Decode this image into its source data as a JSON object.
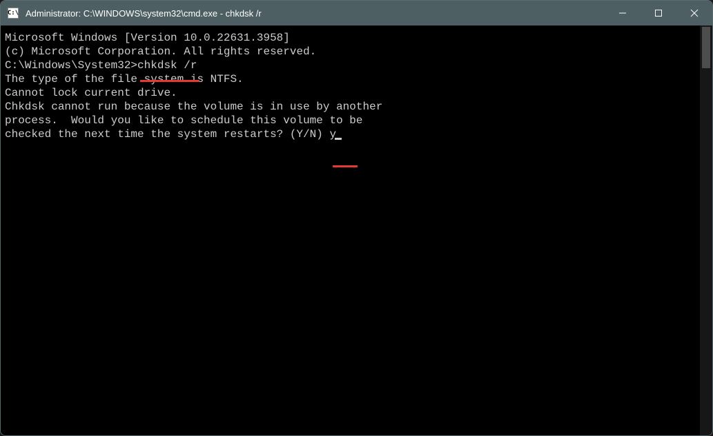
{
  "window": {
    "title": "Administrator: C:\\WINDOWS\\system32\\cmd.exe - chkdsk  /r",
    "icon_label": "C:\\"
  },
  "terminal": {
    "line1": "Microsoft Windows [Version 10.0.22631.3958]",
    "line2": "(c) Microsoft Corporation. All rights reserved.",
    "blank1": "",
    "prompt_prefix": "C:\\Windows\\System32>",
    "prompt_command": "chkdsk /r",
    "line4": "The type of the file system is NTFS.",
    "line5": "Cannot lock current drive.",
    "blank2": "",
    "line6": "Chkdsk cannot run because the volume is in use by another",
    "line7": "process.  Would you like to schedule this volume to be",
    "line8_prefix": "checked the next time the system restarts? (Y/N) ",
    "line8_input": "y"
  }
}
